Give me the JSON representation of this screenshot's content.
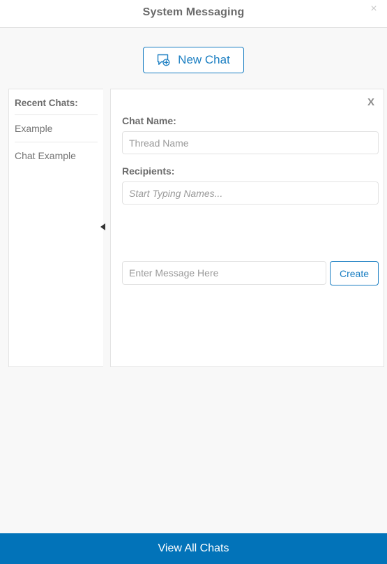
{
  "header": {
    "title": "System Messaging",
    "close_label": "×",
    "close_icon": "close-icon"
  },
  "toolbar": {
    "new_chat_label": "New Chat",
    "new_chat_icon": "new-chat-bubble-plus-icon"
  },
  "sidebar": {
    "title": "Recent Chats:",
    "collapse_icon": "triangle-left-icon",
    "items": [
      {
        "label": "Example"
      },
      {
        "label": "Chat Example"
      }
    ]
  },
  "compose": {
    "close_label": "X",
    "close_icon": "close-icon",
    "chat_name_label": "Chat Name:",
    "chat_name_value": "",
    "chat_name_placeholder": "Thread Name",
    "recipients_label": "Recipients:",
    "recipients_value": "",
    "recipients_placeholder": "Start Typing Names...",
    "message_value": "",
    "message_placeholder": "Enter Message Here",
    "create_label": "Create"
  },
  "footer": {
    "view_all_label": "View All Chats"
  },
  "colors": {
    "accent_blue": "#1a7ec2",
    "footer_blue": "#0273b9",
    "page_background": "#f8f8f8",
    "panel_background": "#ffffff",
    "border_gray": "#e3e3e3",
    "text_gray": "#6b6b6b"
  }
}
